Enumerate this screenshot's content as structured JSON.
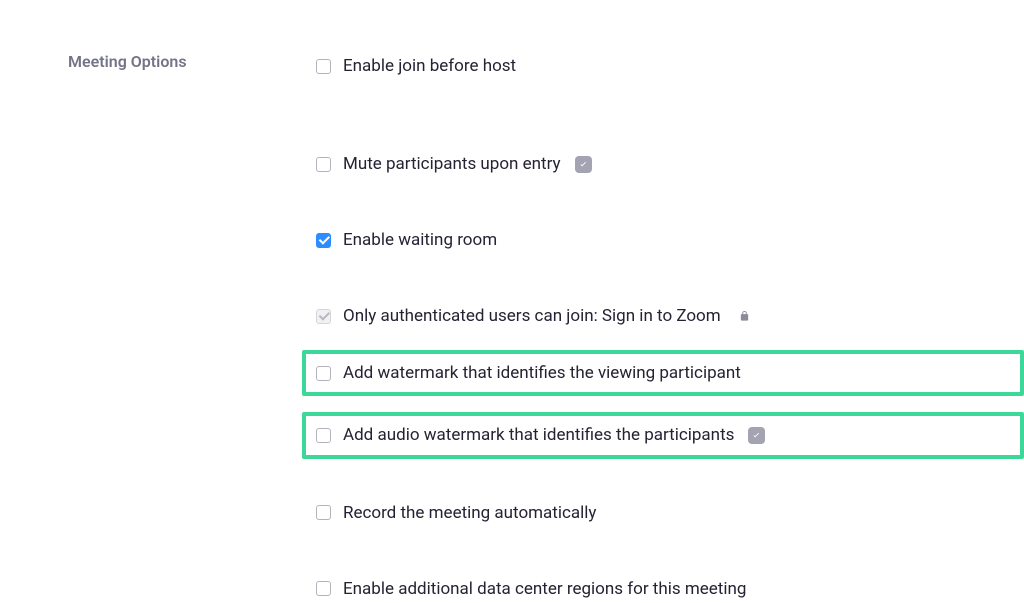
{
  "section_title": "Meeting Options",
  "options": {
    "join_before_host": {
      "label": "Enable join before host",
      "checked": false,
      "highlighted": false,
      "has_info": false,
      "has_lock": false,
      "disabled": false
    },
    "mute_on_entry": {
      "label": "Mute participants upon entry",
      "checked": false,
      "highlighted": false,
      "has_info": true,
      "has_lock": false,
      "disabled": false
    },
    "waiting_room": {
      "label": "Enable waiting room",
      "checked": true,
      "highlighted": false,
      "has_info": false,
      "has_lock": false,
      "disabled": false
    },
    "authenticated_only": {
      "label": "Only authenticated users can join: Sign in to Zoom",
      "checked": true,
      "highlighted": false,
      "has_info": false,
      "has_lock": true,
      "disabled": true
    },
    "video_watermark": {
      "label": "Add watermark that identifies the viewing participant",
      "checked": false,
      "highlighted": true,
      "has_info": false,
      "has_lock": false,
      "disabled": false
    },
    "audio_watermark": {
      "label": "Add audio watermark that identifies the participants",
      "checked": false,
      "highlighted": true,
      "has_info": true,
      "has_lock": false,
      "disabled": false
    },
    "auto_record": {
      "label": "Record the meeting automatically",
      "checked": false,
      "highlighted": false,
      "has_info": false,
      "has_lock": false,
      "disabled": false
    },
    "data_center_regions": {
      "label": "Enable additional data center regions for this meeting",
      "checked": false,
      "highlighted": false,
      "has_info": false,
      "has_lock": false,
      "disabled": false
    }
  }
}
